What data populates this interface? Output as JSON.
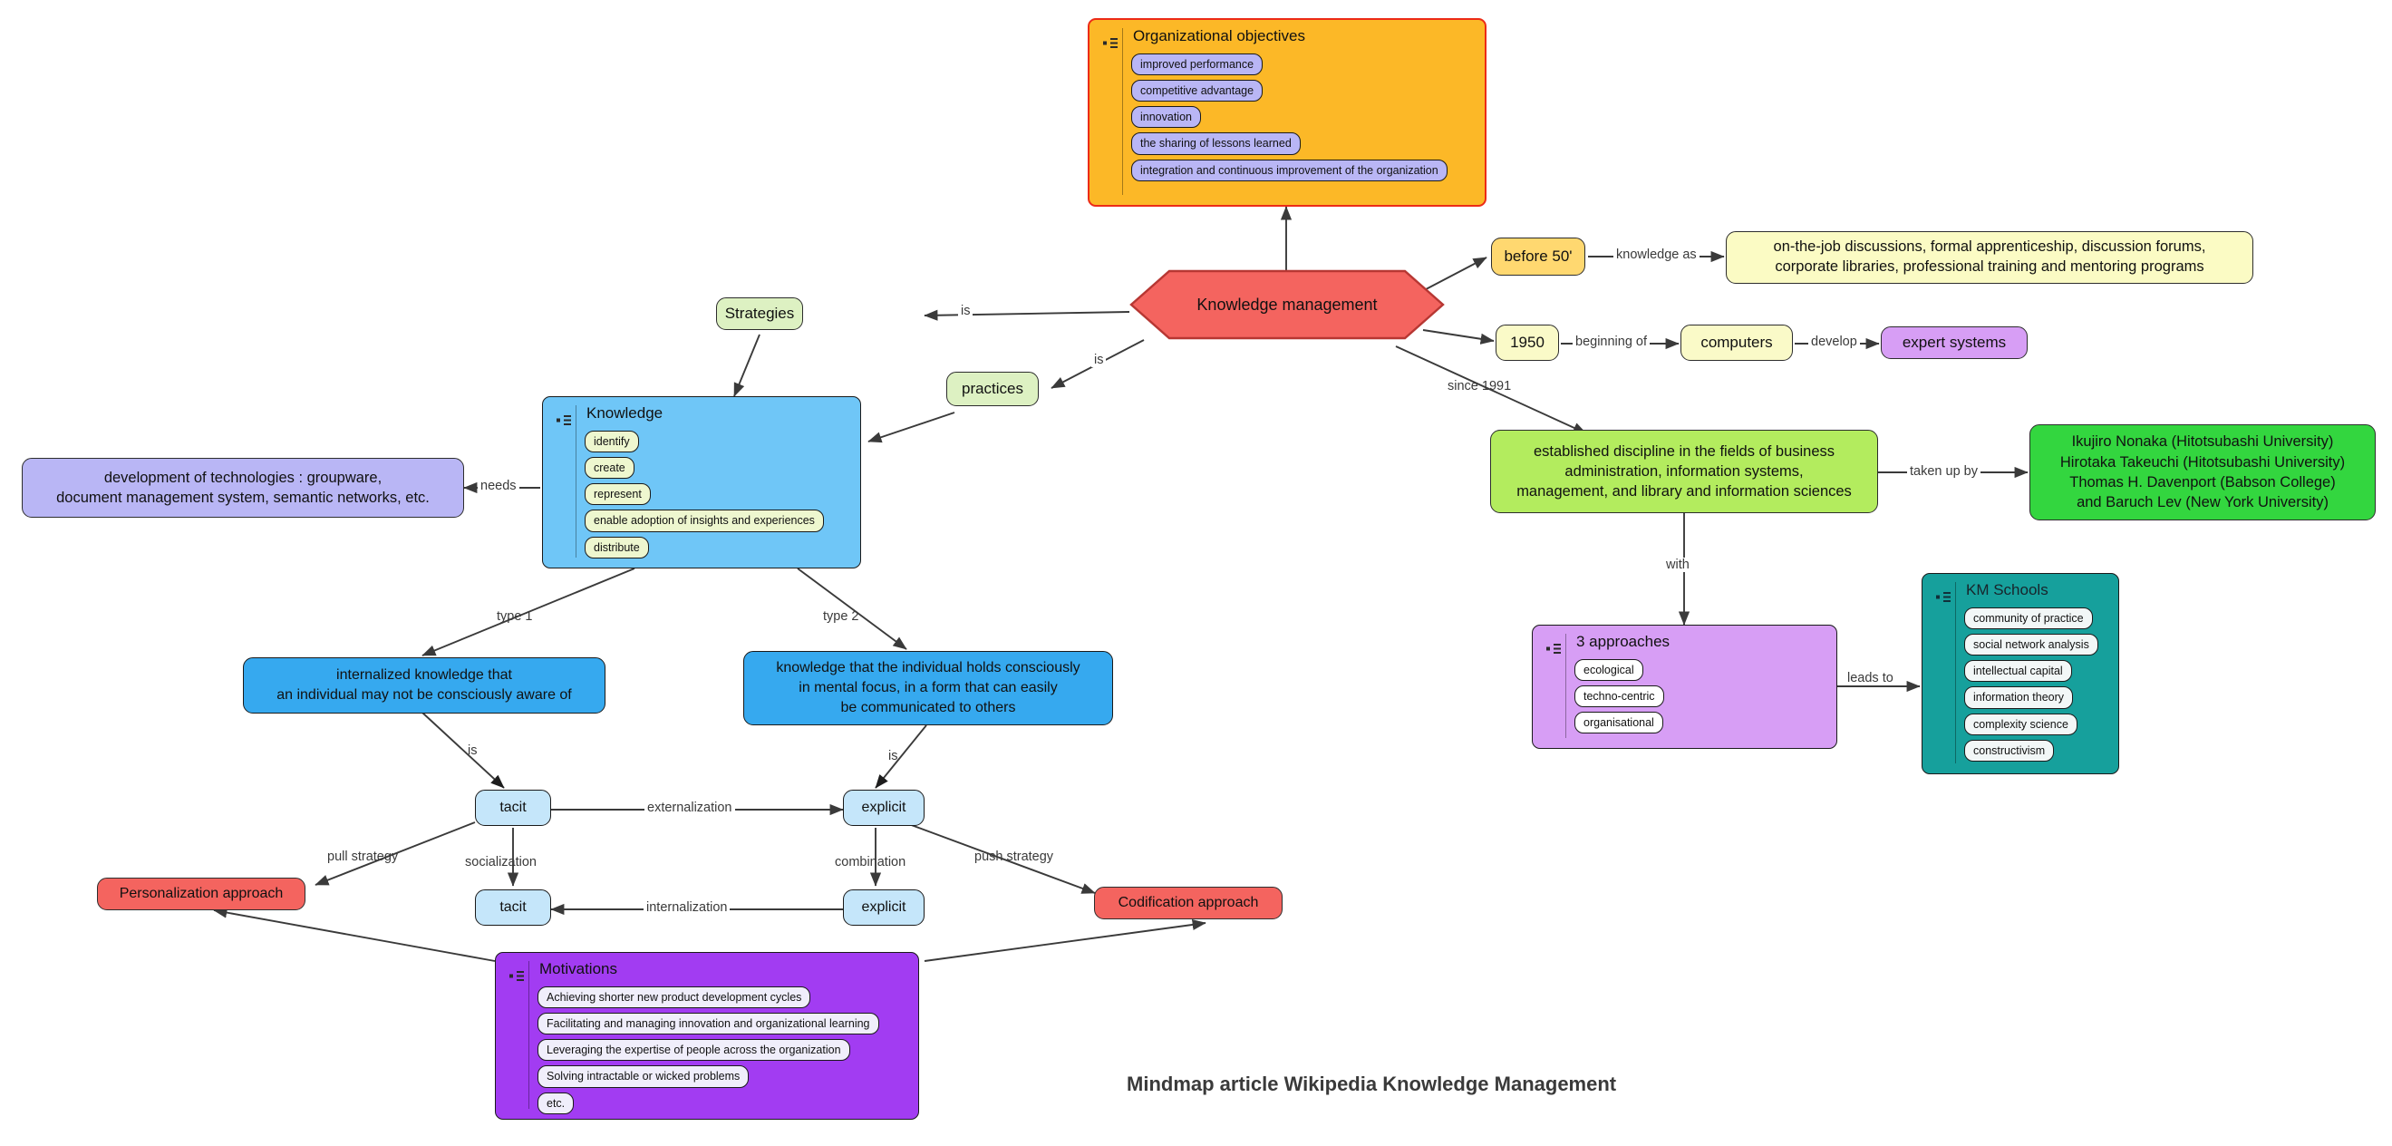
{
  "diagram": {
    "footer_title": "Mindmap article Wikipedia Knowledge Management",
    "root": {
      "label": "Knowledge management"
    }
  },
  "nodes": {
    "organizational_objectives": {
      "title": "Organizational objectives",
      "items": [
        "improved performance",
        "competitive advantage",
        "innovation",
        "the sharing of lessons learned",
        "integration and continuous improvement of the organization"
      ]
    },
    "knowledge": {
      "title": "Knowledge",
      "items": [
        "identify",
        "create",
        "represent",
        "enable adoption of insights and experiences",
        "distribute"
      ]
    },
    "approaches": {
      "title": "3 approaches",
      "items": [
        "ecological",
        "techno-centric",
        "organisational"
      ]
    },
    "km_schools": {
      "title": "KM Schools",
      "items": [
        "community of practice",
        "social network analysis",
        "intellectual capital",
        "information theory",
        "complexity science",
        "constructivism"
      ]
    },
    "motivations": {
      "title": "Motivations",
      "items": [
        "Achieving shorter new product development cycles",
        "Facilitating and managing innovation and organizational learning",
        "Leveraging the expertise of people across the organization",
        "Solving intractable or wicked problems",
        "etc."
      ]
    },
    "strategies": {
      "label": "Strategies"
    },
    "practices": {
      "label": "practices"
    },
    "before50": {
      "label": "before 50'"
    },
    "knowledge_as": {
      "line1": "on-the-job discussions, formal apprenticeship, discussion forums,",
      "line2": "corporate libraries, professional training and mentoring programs"
    },
    "year1950": {
      "label": "1950"
    },
    "computers": {
      "label": "computers"
    },
    "expert_systems": {
      "label": "expert systems"
    },
    "established_discipline": {
      "line1": "established discipline in the fields of business",
      "line2": "administration, information systems,",
      "line3": "management, and library and information sciences"
    },
    "researchers": {
      "line1": "Ikujiro Nonaka (Hitotsubashi University)",
      "line2": "Hirotaka Takeuchi (Hitotsubashi University)",
      "line3": "Thomas H. Davenport (Babson College)",
      "line4": "and Baruch Lev (New York University)"
    },
    "technologies": {
      "line1": "development of technologies : groupware,",
      "line2": "document management system, semantic networks, etc."
    },
    "type1": {
      "line1": "internalized knowledge that",
      "line2": "an individual may not be consciously aware of"
    },
    "type2": {
      "line1": "knowledge that the individual holds consciously",
      "line2": "in mental focus, in a form that can easily",
      "line3": "be communicated to others"
    },
    "tacit_top": {
      "label": "tacit"
    },
    "explicit_top": {
      "label": "explicit"
    },
    "tacit_bottom": {
      "label": "tacit"
    },
    "explicit_bottom": {
      "label": "explicit"
    },
    "personalization": {
      "label": "Personalization approach"
    },
    "codification": {
      "label": "Codification approach"
    }
  },
  "edge_labels": {
    "is_strategies": "is",
    "is_practices": "is",
    "knowledge_as": "knowledge as",
    "beginning_of": "beginning of",
    "develop": "develop",
    "since_1991": "since 1991",
    "taken_up_by": "taken up by",
    "with": "with",
    "leads_to": "leads to",
    "needs": "needs",
    "type1": "type 1",
    "type2": "type 2",
    "is_tacit": "is",
    "is_explicit": "is",
    "externalization": "externalization",
    "socialization": "socialization",
    "combination": "combination",
    "internalization": "internalization",
    "pull_strategy": "pull strategy",
    "push_strategy": "push strategy"
  },
  "colors": {
    "root": "#f4645f",
    "orange": "#fcb827",
    "orange_border": "#ec2b16",
    "blue": "#6fc6f7",
    "blue_strong": "#36a9ef",
    "light_blue": "#c5e6fa",
    "purple": "#d79ef5",
    "violet": "#a23cf2",
    "teal": "#16a09c",
    "green_light": "#b3ec5e",
    "green_bold": "#33d63f",
    "green_pale": "#ddf1c2",
    "yellow": "#fbfbc4",
    "amber": "#ffd870",
    "lilac": "#b9b6f5",
    "red": "#f4645f",
    "edge": "#3a3a3a"
  }
}
